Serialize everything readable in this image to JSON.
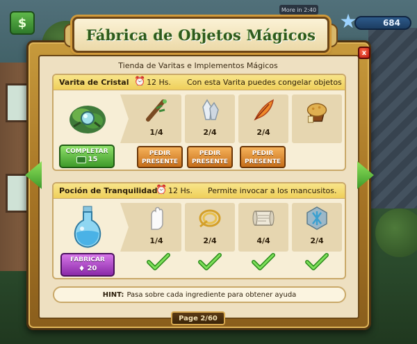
{
  "hud": {
    "timer_text": "More in 2:40",
    "counter_value": "684",
    "left_icon": "gift-icon",
    "star_icon": "star-icon"
  },
  "dialog": {
    "title": "Fábrica de Objetos Mágicos",
    "subtitle": "Tienda de Varitas e Implementos Mágicos",
    "close_label": "x",
    "hint_label": "HINT:",
    "hint_text": "Pasa sobre cada ingrediente para obtener ayuda",
    "page_text": "Page 2/60"
  },
  "colors": {
    "title_green": "#2f5a1c",
    "section_header": "#efcf5a",
    "button_green": "#3e9a2a",
    "button_orange": "#c66e1a",
    "button_purple": "#8a2aa8",
    "check_green": "#3aa32a"
  },
  "items": [
    {
      "name": "Varita de Cristal",
      "time": "12 Hs.",
      "description": "Con esta Varita puedes congelar objetos",
      "image_icon": "crystal-wand-icon",
      "action_label": "COMPLETAR",
      "action_cost": "15",
      "action_cost_icon": "cash-icon",
      "ingredients": [
        {
          "icon": "branch-icon",
          "count": "1/4",
          "request_label_1": "PEDIR",
          "request_label_2": "PRESENTE"
        },
        {
          "icon": "crystal-icon",
          "count": "2/4",
          "request_label_1": "PEDIR",
          "request_label_2": "PRESENTE"
        },
        {
          "icon": "feather-icon",
          "count": "2/4",
          "request_label_1": "PEDIR",
          "request_label_2": "PRESENTE"
        },
        {
          "icon": "muffin-icon",
          "count": ""
        }
      ]
    },
    {
      "name": "Poción de Tranquilidad",
      "time": "12 Hs.",
      "description": "Permite invocar a los mancusitos.",
      "image_icon": "potion-icon",
      "action_label": "FABRICAR",
      "action_cost": "20",
      "action_cost_icon": "gem-icon",
      "ingredients": [
        {
          "icon": "glove-icon",
          "count": "1/4"
        },
        {
          "icon": "rope-icon",
          "count": "2/4"
        },
        {
          "icon": "scroll-icon",
          "count": "4/4"
        },
        {
          "icon": "rune-stone-icon",
          "count": "2/4"
        }
      ]
    }
  ]
}
